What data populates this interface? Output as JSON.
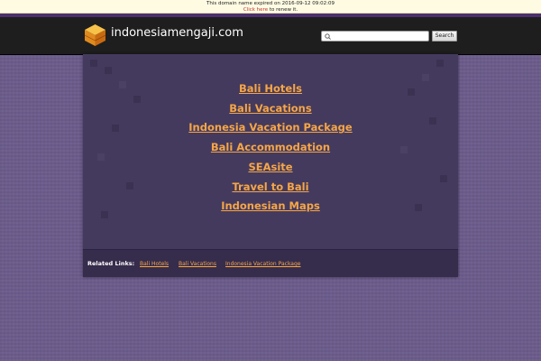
{
  "notice": {
    "expired_text": "This domain name expired on 2016-09-12 09:02:09",
    "click_here": "Click here",
    "renew_text": " to renew it."
  },
  "header": {
    "site_name": "indonesiamengaji.com",
    "search_placeholder": "",
    "search_button": "Search"
  },
  "main": {
    "links": [
      "Bali Hotels",
      "Bali Vacations",
      "Indonesia Vacation Package",
      "Bali Accommodation",
      "SEAsite",
      "Travel to Bali",
      "Indonesian Maps"
    ]
  },
  "related": {
    "label": "Related Links:",
    "links": [
      "Bali Hotels",
      "Bali Vacations",
      "Indonesia Vacation Package"
    ]
  },
  "colors": {
    "link": "#f6a646",
    "header_bg": "#1e1e1e",
    "panel_bg": "#443a5e",
    "page_bg": "#6b5b8b",
    "accent_strip": "#4c2f6e"
  }
}
